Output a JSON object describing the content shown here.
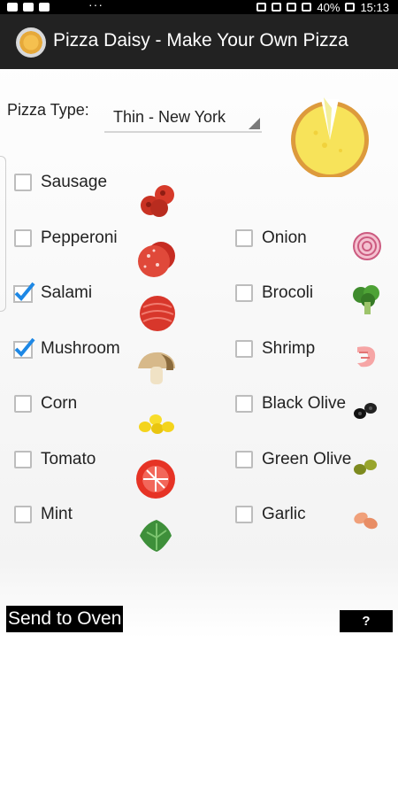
{
  "status_bar": {
    "dots": "···",
    "battery": "40%",
    "time": "15:13"
  },
  "app": {
    "title": "Pizza Daisy - Make Your Own Pizza"
  },
  "pizza_type": {
    "label": "Pizza Type:",
    "value": "Thin - New York"
  },
  "toppings_left": [
    {
      "label": "Sausage",
      "checked": false
    },
    {
      "label": "Pepperoni",
      "checked": false
    },
    {
      "label": "Salami",
      "checked": true
    },
    {
      "label": "Mushroom",
      "checked": true
    },
    {
      "label": "Corn",
      "checked": false
    },
    {
      "label": "Tomato",
      "checked": false
    },
    {
      "label": "Mint",
      "checked": false
    }
  ],
  "toppings_right": [
    {
      "label": "Onion",
      "checked": false
    },
    {
      "label": "Brocoli",
      "checked": false
    },
    {
      "label": "Shrimp",
      "checked": false
    },
    {
      "label": "Black Olive",
      "checked": false
    },
    {
      "label": "Green Olive",
      "checked": false
    },
    {
      "label": "Garlic",
      "checked": false
    }
  ],
  "buttons": {
    "send": "Send to Oven",
    "help": "?"
  },
  "colors": {
    "check": "#1e88e5",
    "app_bar": "#222222"
  }
}
